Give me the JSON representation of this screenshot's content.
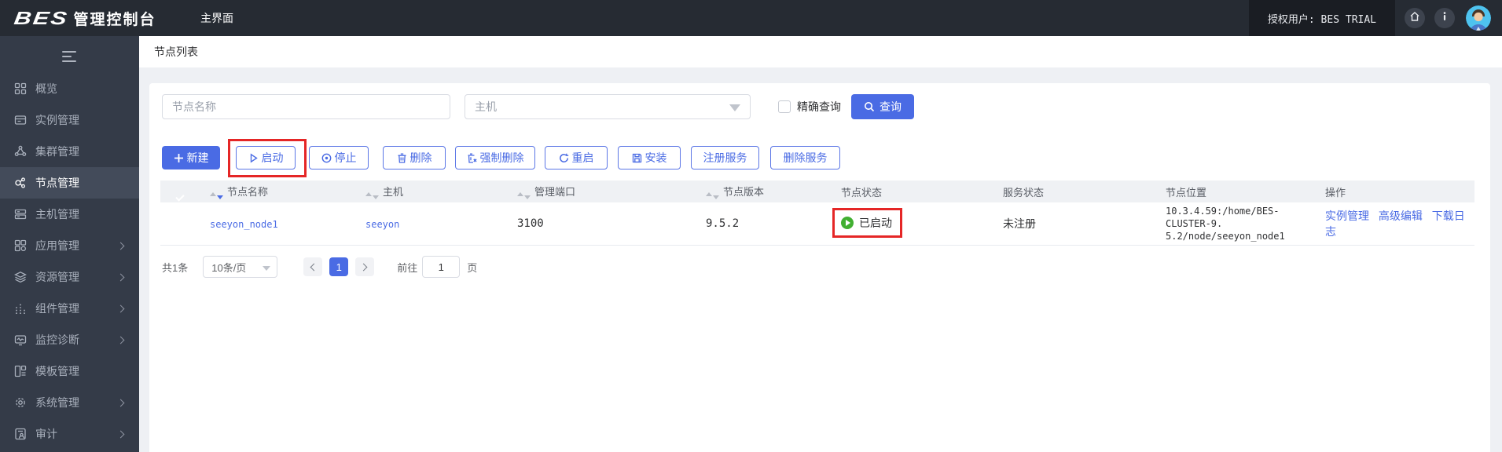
{
  "header": {
    "logo": "BES",
    "product": "管理控制台",
    "tab": "主界面",
    "license": "授权用户: BES TRIAL"
  },
  "sidebar": {
    "items": [
      {
        "label": "概览",
        "icon": "overview-grid-icon",
        "active": false,
        "expandable": false
      },
      {
        "label": "实例管理",
        "icon": "instance-icon",
        "active": false,
        "expandable": false
      },
      {
        "label": "集群管理",
        "icon": "cluster-icon",
        "active": false,
        "expandable": false
      },
      {
        "label": "节点管理",
        "icon": "node-icon",
        "active": true,
        "expandable": false
      },
      {
        "label": "主机管理",
        "icon": "host-icon",
        "active": false,
        "expandable": false
      },
      {
        "label": "应用管理",
        "icon": "app-icon",
        "active": false,
        "expandable": true
      },
      {
        "label": "资源管理",
        "icon": "resource-layers-icon",
        "active": false,
        "expandable": true
      },
      {
        "label": "组件管理",
        "icon": "component-icon",
        "active": false,
        "expandable": true
      },
      {
        "label": "监控诊断",
        "icon": "monitor-icon",
        "active": false,
        "expandable": true
      },
      {
        "label": "模板管理",
        "icon": "template-icon",
        "active": false,
        "expandable": false
      },
      {
        "label": "系统管理",
        "icon": "gear-icon",
        "active": false,
        "expandable": true
      },
      {
        "label": "审计",
        "icon": "audit-icon",
        "active": false,
        "expandable": true
      }
    ]
  },
  "page": {
    "title": "节点列表",
    "search": {
      "node_name_placeholder": "节点名称",
      "host_placeholder": "主机",
      "exact_label": "精确查询",
      "query_label": "查询"
    },
    "toolbar": {
      "buttons": [
        {
          "label": "新建"
        },
        {
          "label": "启动"
        },
        {
          "label": "停止"
        },
        {
          "label": "删除"
        },
        {
          "label": "强制删除"
        },
        {
          "label": "重启"
        },
        {
          "label": "安装"
        },
        {
          "label": "注册服务"
        },
        {
          "label": "删除服务"
        }
      ]
    },
    "table": {
      "columns": [
        "节点名称",
        "主机",
        "管理端口",
        "节点版本",
        "节点状态",
        "服务状态",
        "节点位置",
        "操作"
      ],
      "rows": [
        {
          "name": "seeyon_node1",
          "host": "seeyon",
          "port": "3100",
          "version": "9.5.2",
          "status": "已启动",
          "service_status": "未注册",
          "location_line1": "10.3.4.59:/home/BES-CLUSTER-9.",
          "location_line2": "5.2/node/seeyon_node1",
          "actions": [
            "实例管理",
            "高级编辑",
            "下载日志"
          ]
        }
      ]
    },
    "pagination": {
      "total": "共1条",
      "page_size": "10条/页",
      "page": "1",
      "goto_label": "前往",
      "goto_value": "1",
      "unit_label": "页"
    }
  },
  "colors": {
    "primary": "#4a6be4",
    "success_green": "#41af31",
    "annotation_red": "#e52626",
    "topbar_bg": "#262b33",
    "sidebar_bg": "#343b48",
    "sidebar_active_bg": "#434b5a",
    "table_header_bg": "#eff1f4"
  }
}
